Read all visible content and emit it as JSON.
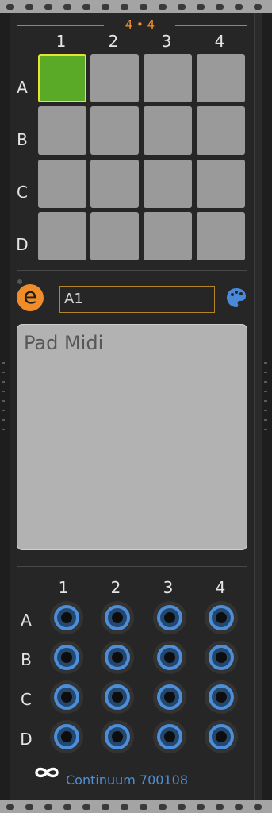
{
  "module": {
    "title": "4 • 4",
    "columns": [
      "1",
      "2",
      "3",
      "4"
    ],
    "rows": [
      "A",
      "B",
      "C",
      "D"
    ],
    "pads": [
      {
        "id": "A1",
        "state": "on"
      },
      {
        "id": "A2",
        "state": "off"
      },
      {
        "id": "A3",
        "state": "off"
      },
      {
        "id": "A4",
        "state": "off"
      },
      {
        "id": "B1",
        "state": "off"
      },
      {
        "id": "B2",
        "state": "off"
      },
      {
        "id": "B3",
        "state": "off"
      },
      {
        "id": "B4",
        "state": "off"
      },
      {
        "id": "C1",
        "state": "off"
      },
      {
        "id": "C2",
        "state": "off"
      },
      {
        "id": "C3",
        "state": "off"
      },
      {
        "id": "C4",
        "state": "off"
      },
      {
        "id": "D1",
        "state": "off"
      },
      {
        "id": "D2",
        "state": "off"
      },
      {
        "id": "D3",
        "state": "off"
      },
      {
        "id": "D4",
        "state": "off"
      }
    ],
    "selected_pad_value": "A1",
    "editor_icon_letter": "e",
    "description": "Pad Midi",
    "jack_columns": [
      "1",
      "2",
      "3",
      "4"
    ],
    "jack_rows": [
      "A",
      "B",
      "C",
      "D"
    ],
    "brand_icon": "infinity-icon",
    "brand_text": "Continuum 700108"
  },
  "colors": {
    "accent_orange": "#f0922e",
    "pad_on": "#5aaa28",
    "pad_on_border": "#e5e52e",
    "pad_off": "#9a9a9a",
    "jack_ring": "#4c8ed8",
    "brand_blue": "#4d8fd6"
  }
}
